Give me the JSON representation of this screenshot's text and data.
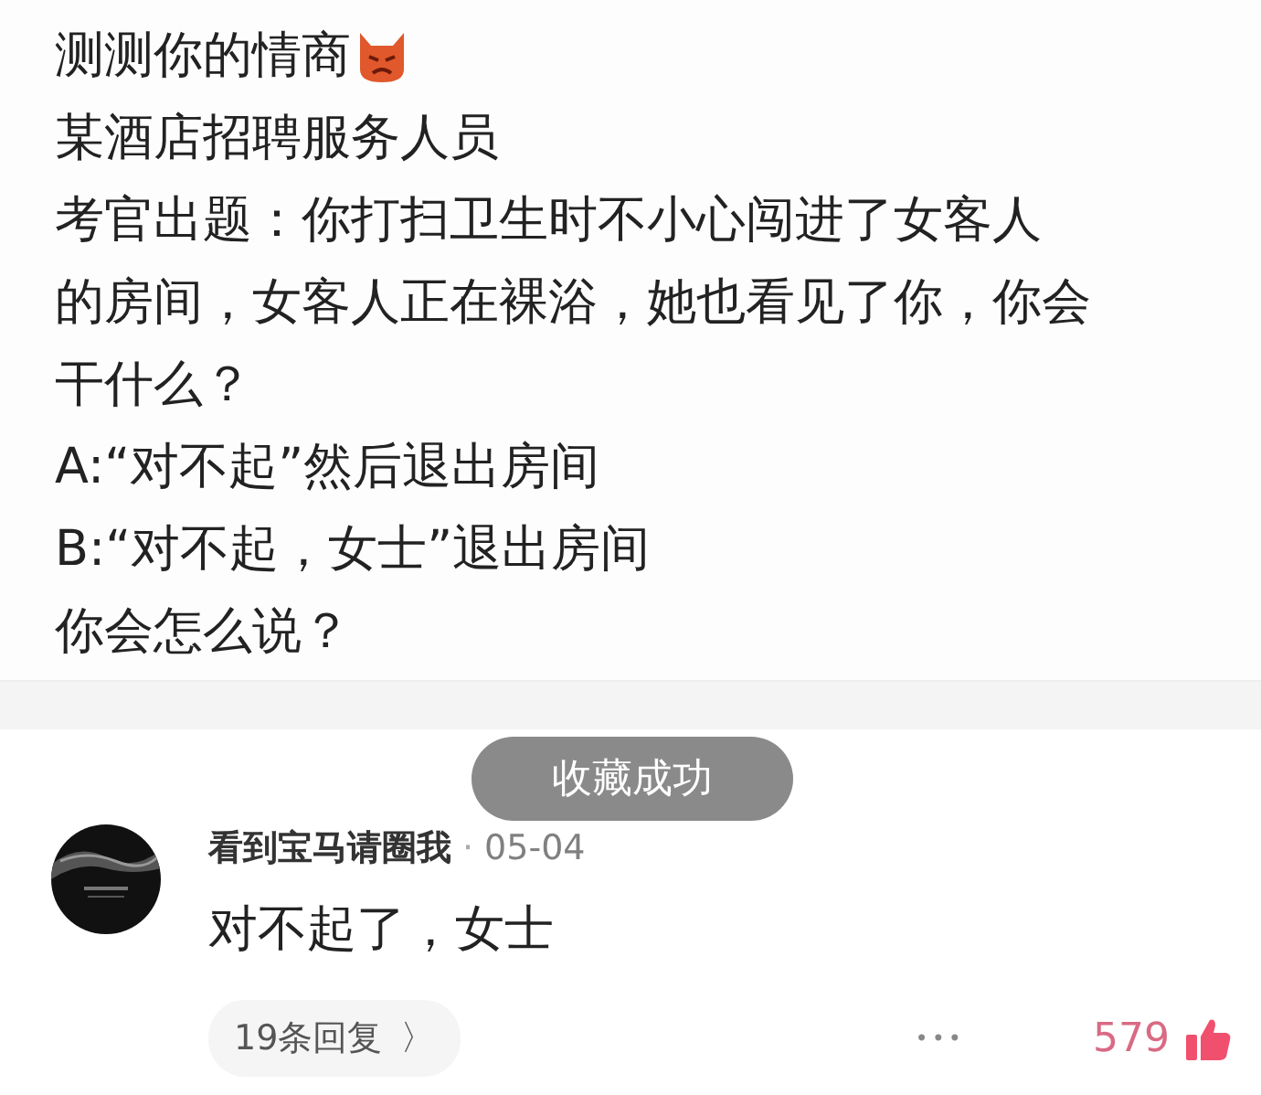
{
  "post": {
    "lines": [
      "测测你的情商",
      "某酒店招聘服务人员",
      "考官出题：你打扫卫生时不小心闯进了女客人",
      "的房间，女客人正在裸浴，她也看见了你，你会",
      "干什么？",
      "A:“对不起”然后退出房间",
      "B:“对不起，女士”退出房间",
      "你会怎么说？"
    ]
  },
  "toast": "收藏成功",
  "comment": {
    "author": "看到宝马请圈我",
    "separator": "·",
    "date": "05-04",
    "text": "对不起了，女士",
    "replies": "19条回复",
    "replies_arrow": "〉",
    "more": "•••",
    "likes": "579",
    "liked": true
  }
}
